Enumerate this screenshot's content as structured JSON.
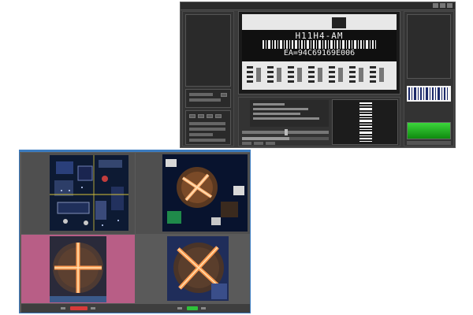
{
  "barcode_window": {
    "decoded_text": "H11H4-AM",
    "ea_text": "EA=94C69169E006",
    "result_color": "#1fbf1f"
  },
  "inspection_window": {
    "accent_color": "#3b7bbf",
    "fail_color": "#d83a3a",
    "pass_color": "#2fc23a"
  }
}
